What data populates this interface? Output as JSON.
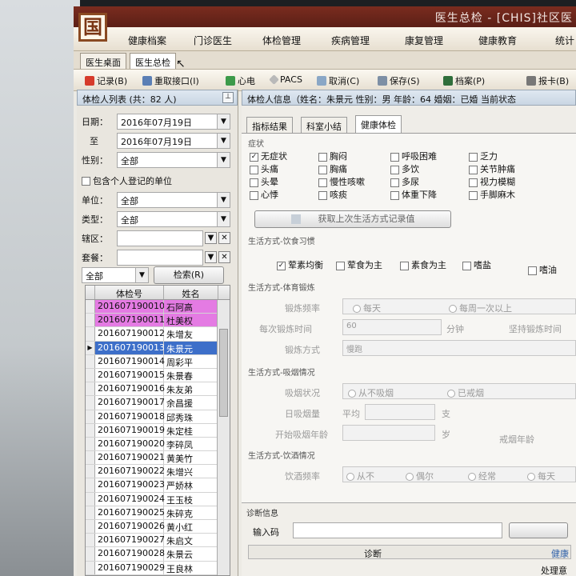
{
  "window": {
    "title": "医生总检 - [CHIS]社区医"
  },
  "logo": {
    "glyph": "国"
  },
  "menu": [
    "健康档案",
    "门诊医生",
    "体检管理",
    "疾病管理",
    "康复管理",
    "健康教育",
    "统计"
  ],
  "tabs": [
    "医生桌面",
    "医生总检"
  ],
  "toolbar": {
    "items": [
      "记录(B)",
      "重取接口(I)",
      "心电",
      "PACS",
      "取消(C)",
      "保存(S)",
      "档案(P)",
      "报卡(B)"
    ]
  },
  "left_panel": {
    "title": "体检人列表 (共：82 人)",
    "pin_icon": "pin-icon",
    "date_label": "日期：",
    "date_from": "2016年07月19日",
    "to_label": "至",
    "date_to": "2016年07月19日",
    "gender_label": "性别：",
    "gender_value": "全部",
    "include_personal_label": "包含个人登记的单位",
    "unit_label": "单位：",
    "unit_value": "全部",
    "type_label": "类型：",
    "type_value": "全部",
    "district_label": "辖区：",
    "package_label": "套餐：",
    "filter_value": "全部",
    "search_button": "检索(R)",
    "grid": {
      "col_id": "体检号",
      "col_name": "姓名",
      "rows": [
        {
          "id": "201607190010",
          "name": "石阿高"
        },
        {
          "id": "201607190011",
          "name": "杜美权"
        },
        {
          "id": "201607190012",
          "name": "朱增友"
        },
        {
          "id": "201607190013",
          "name": "朱景元"
        },
        {
          "id": "201607190014",
          "name": "周彩平"
        },
        {
          "id": "201607190015",
          "name": "朱景春"
        },
        {
          "id": "201607190016",
          "name": "朱友弟"
        },
        {
          "id": "201607190017",
          "name": "余昌援"
        },
        {
          "id": "201607190018",
          "name": "邱秀珠"
        },
        {
          "id": "201607190019",
          "name": "朱定桂"
        },
        {
          "id": "201607190020",
          "name": "李碎凤"
        },
        {
          "id": "201607190021",
          "name": "黄美竹"
        },
        {
          "id": "201607190022",
          "name": "朱增兴"
        },
        {
          "id": "201607190023",
          "name": "严娇林"
        },
        {
          "id": "201607190024",
          "name": "王玉枝"
        },
        {
          "id": "201607190025",
          "name": "朱碎克"
        },
        {
          "id": "201607190026",
          "name": "黄小红"
        },
        {
          "id": "201607190027",
          "name": "朱启文"
        },
        {
          "id": "201607190028",
          "name": "朱景云"
        },
        {
          "id": "201607190029",
          "name": "王良林"
        }
      ]
    }
  },
  "right_panel": {
    "header": "体检人信息（姓名：朱景元 性别：男 年龄：64 婚姻：已婚 当前状态",
    "tabs": [
      "指标结果",
      "科室小结",
      "健康体检"
    ],
    "symptom_title": "症状",
    "symptoms": [
      [
        "无症状",
        "胸闷",
        "呼吸困难",
        "乏力"
      ],
      [
        "头痛",
        "胸痛",
        "多饮",
        "关节肿痛"
      ],
      [
        "头晕",
        "慢性咳嗽",
        "多尿",
        "视力模糊"
      ],
      [
        "心悸",
        "咳痰",
        "体重下降",
        "手脚麻木"
      ]
    ],
    "fetch_button": "获取上次生活方式记录值",
    "diet_title": "生活方式-饮食习惯",
    "diet": [
      "荤素均衡",
      "荤食为主",
      "素食为主",
      "嗜盐",
      "嗜油"
    ],
    "exercise_title": "生活方式-体育锻炼",
    "exercise_freq_label": "锻炼频率",
    "exercise_freq_opts": [
      "每天",
      "每周一次以上"
    ],
    "exercise_time_label": "每次锻炼时间",
    "exercise_time_value": "60",
    "exercise_time_unit": "分钟",
    "persist_label": "坚持锻炼时间",
    "exercise_mode_label": "锻炼方式",
    "exercise_mode_value": "慢跑",
    "smoke_title": "生活方式-吸烟情况",
    "smoke_status_label": "吸烟状况",
    "smoke_opts": [
      "从不吸烟",
      "已戒烟"
    ],
    "daily_smoke_label": "日吸烟量",
    "daily_smoke_avg": "平均",
    "daily_smoke_unit": "支",
    "start_smoke_label": "开始吸烟年龄",
    "start_smoke_unit": "岁",
    "quit_smoke_label": "戒烟年龄",
    "drink_title": "生活方式-饮酒情况",
    "drink_freq_label": "饮酒频率",
    "drink_opts": [
      "从不",
      "偶尔",
      "经常",
      "每天"
    ],
    "diag_title": "诊断信息",
    "input_code_label": "输入码",
    "diag_col": "诊断",
    "health_label": "健康",
    "process_label": "处理意"
  },
  "colors": {
    "accent_pink": "#e47be3",
    "selected_blue": "#3d6fc9",
    "titlebar": "#6b261a"
  }
}
